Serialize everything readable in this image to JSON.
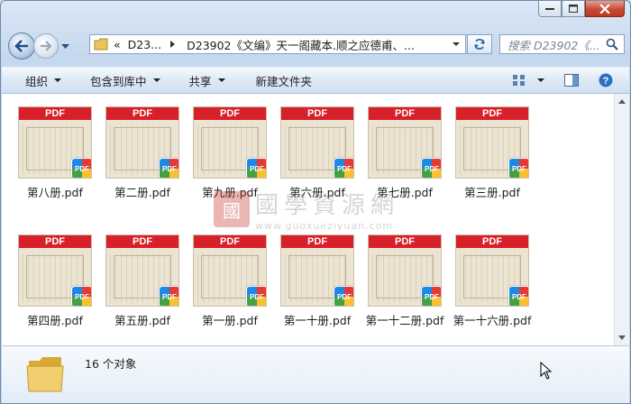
{
  "window": {
    "caption_buttons": [
      "minimize",
      "maximize",
      "close"
    ]
  },
  "address": {
    "overflow": "«",
    "crumbs": [
      "D23...",
      "D23902《文编》天一阁藏本.顺之应德甫、..."
    ]
  },
  "search": {
    "placeholder": "搜索 D23902《..."
  },
  "toolbar": {
    "organize": "组织",
    "include_library": "包含到库中",
    "share": "共享",
    "new_folder": "新建文件夹"
  },
  "files": [
    {
      "name": "第八册.pdf"
    },
    {
      "name": "第二册.pdf"
    },
    {
      "name": "第九册.pdf"
    },
    {
      "name": "第六册.pdf"
    },
    {
      "name": "第七册.pdf"
    },
    {
      "name": "第三册.pdf"
    },
    {
      "name": "第四册.pdf"
    },
    {
      "name": "第五册.pdf"
    },
    {
      "name": "第一册.pdf"
    },
    {
      "name": "第一十册.pdf"
    },
    {
      "name": "第一十二册.pdf"
    },
    {
      "name": "第一十六册.pdf"
    }
  ],
  "thumb_banner": "PDF",
  "thumb_badge": "PDF",
  "watermark": {
    "seal": "國",
    "title": "國學資源網",
    "url": "www.guoxueziyuan.com"
  },
  "details": {
    "count": "16 个对象"
  },
  "colors": {
    "pdf_red": "#d8202a",
    "window_blue": "#c5d8ee"
  }
}
